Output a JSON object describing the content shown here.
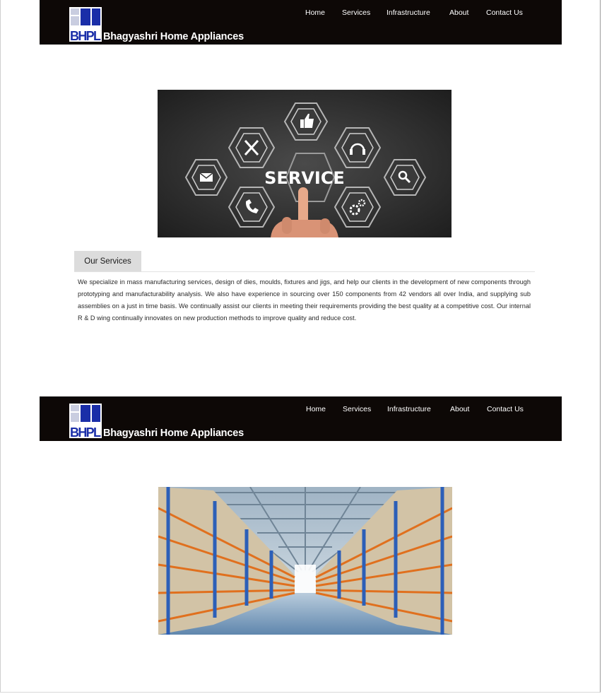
{
  "site": {
    "logo_text": "BHPL",
    "brand_name": "Bhagyashri Home Appliances"
  },
  "nav": {
    "items": [
      "Home",
      "Services",
      "Infrastructure",
      "About",
      "Contact Us"
    ]
  },
  "hero": {
    "center_text": "SERVICE",
    "icons": [
      "thumbs-up-icon",
      "tools-icon",
      "headset-icon",
      "mail-icon",
      "search-icon",
      "phone-icon",
      "gears-icon"
    ]
  },
  "services": {
    "tab_label": "Our Services",
    "description": "We specialize in mass manufacturing services, design of dies, moulds, fixtures and jigs, and help our clients in the development of new components through prototyping and manufacturability analysis. We also have experience in sourcing over 150 components from 42 vendors all over India, and supplying sub assemblies on a just in time basis. We continually assist our clients in meeting their requirements providing the best quality at a competitive cost. Our internal R & D wing continually innovates on new production methods to improve quality and reduce cost."
  },
  "colors": {
    "navbar_bg": "#0d0806",
    "logo_blue": "#1a2ea8",
    "tab_bg": "#dcdcdc"
  }
}
